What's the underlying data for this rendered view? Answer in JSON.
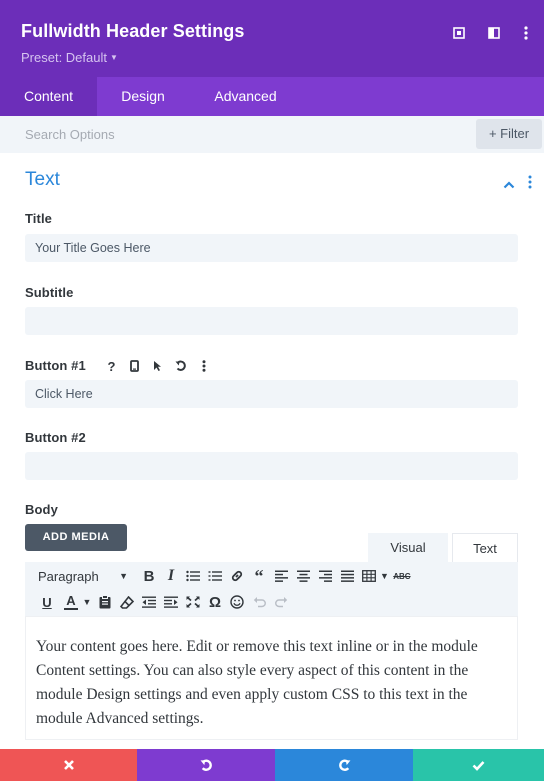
{
  "header": {
    "title": "Fullwidth Header Settings",
    "preset": "Preset: Default",
    "icons": [
      "expand-icon",
      "sidebar-icon",
      "more-icon"
    ]
  },
  "tabs": [
    {
      "label": "Content",
      "active": true
    },
    {
      "label": "Design",
      "active": false
    },
    {
      "label": "Advanced",
      "active": false
    }
  ],
  "search": {
    "placeholder": "Search Options",
    "filter_label": "+ Filter"
  },
  "section": {
    "title": "Text",
    "collapse_icon": "chevron-up-icon",
    "more_icon": "more-icon"
  },
  "fields": {
    "title": {
      "label": "Title",
      "value": "Your Title Goes Here"
    },
    "subtitle": {
      "label": "Subtitle",
      "value": ""
    },
    "button1": {
      "label": "Button #1",
      "value": "Click Here",
      "icons": [
        "help-icon",
        "mobile-icon",
        "cursor-icon",
        "undo-icon",
        "more-icon"
      ]
    },
    "button2": {
      "label": "Button #2",
      "value": ""
    },
    "body": {
      "label": "Body"
    }
  },
  "editor": {
    "add_media": "ADD MEDIA",
    "mode_visual": "Visual",
    "mode_text": "Text",
    "paragraph": "Paragraph",
    "content": "Your content goes here. Edit or remove this text inline or in the module Content settings. You can also style every aspect of this content in the module Design settings and even apply custom CSS to this text in the module Advanced settings."
  },
  "footer": {
    "buttons": [
      {
        "name": "discard",
        "color": "#ef5555",
        "icon": "close-icon"
      },
      {
        "name": "undo",
        "color": "#7e3bd0",
        "icon": "undo-icon"
      },
      {
        "name": "redo",
        "color": "#2b87da",
        "icon": "redo-icon"
      },
      {
        "name": "save",
        "color": "#29c4a9",
        "icon": "check-icon"
      }
    ]
  },
  "colors": {
    "header": "#6c2eb9",
    "tabs": "#7e3bd0",
    "accent": "#2b87da"
  }
}
